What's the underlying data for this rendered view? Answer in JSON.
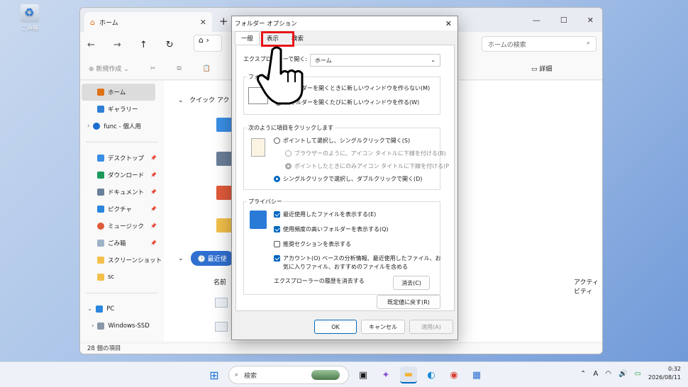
{
  "desktop": {
    "recycle_label": "ごみ箱"
  },
  "explorer": {
    "tab_title": "ホーム",
    "search_placeholder": "ホームの検索",
    "new_label": "新規作成",
    "details_label": "詳細",
    "sidebar": [
      {
        "label": "ホーム",
        "icon": "home-icon"
      },
      {
        "label": "ギャラリー",
        "icon": "gallery-icon"
      },
      {
        "label": "func - 個人用",
        "icon": "cloud-icon"
      },
      {
        "label": "デスクトップ",
        "icon": "desktop-icon"
      },
      {
        "label": "ダウンロード",
        "icon": "download-icon"
      },
      {
        "label": "ドキュメント",
        "icon": "document-icon"
      },
      {
        "label": "ピクチャ",
        "icon": "pictures-icon"
      },
      {
        "label": "ミュージック",
        "icon": "music-icon"
      },
      {
        "label": "ごみ箱",
        "icon": "recycle-icon"
      },
      {
        "label": "スクリーンショット",
        "icon": "folder-icon"
      },
      {
        "label": "sc",
        "icon": "folder-icon"
      },
      {
        "label": "PC",
        "icon": "pc-icon"
      },
      {
        "label": "Windows-SSD",
        "icon": "drive-icon"
      }
    ],
    "quick_access": "クイック アク",
    "recent": "最近使",
    "col_name": "名前",
    "col_activity": "アクティビティ",
    "status": "28 個の項目"
  },
  "dialog": {
    "title": "フォルダー オプション",
    "tabs": [
      "一般",
      "表示",
      "検索"
    ],
    "open_label": "エクスプローラーで開く:",
    "open_value": "ホーム",
    "browse_group": "フォルダーの参照",
    "browse_opt1": "フォルダーを開くときに新しいウィンドウを作らない(M)",
    "browse_opt2": "フォルダーを開くたびに新しいウィンドウを作る(W)",
    "click_group": "次のように項目をクリックします",
    "click_opt1": "ポイントして選択し、シングルクリックで開く(S)",
    "click_sub1": "ブラウザーのように、アイコン タイトルに下線を付ける(B)",
    "click_sub2": "ポイントしたときにのみアイコン タイトルに下線を付ける(P",
    "click_opt2": "シングルクリックで選択し、ダブルクリックで開く(D)",
    "privacy_group": "プライバシー",
    "priv1": "最近使用したファイルを表示する(E)",
    "priv2": "使用頻度の高いフォルダーを表示する(Q)",
    "priv3": "推奨セクションを表示する",
    "priv4a": "アカウント(O) ベースの分析情報、最近使用したファイル、お",
    "priv4b": "気に入りファイル、おすすめのファイルを含める",
    "history_label": "エクスプローラーの履歴を消去する",
    "clear_btn": "消去(C)",
    "default_btn": "既定値に戻す(R)",
    "ok_btn": "OK",
    "cancel_btn": "キャンセル",
    "apply_btn": "適用(A)"
  },
  "taskbar": {
    "search_placeholder": "検索",
    "time": "0:32",
    "date": "2026/08/11",
    "ime": "A"
  },
  "colors": {
    "accent": "#0067c0",
    "highlight": "#e8141a"
  }
}
